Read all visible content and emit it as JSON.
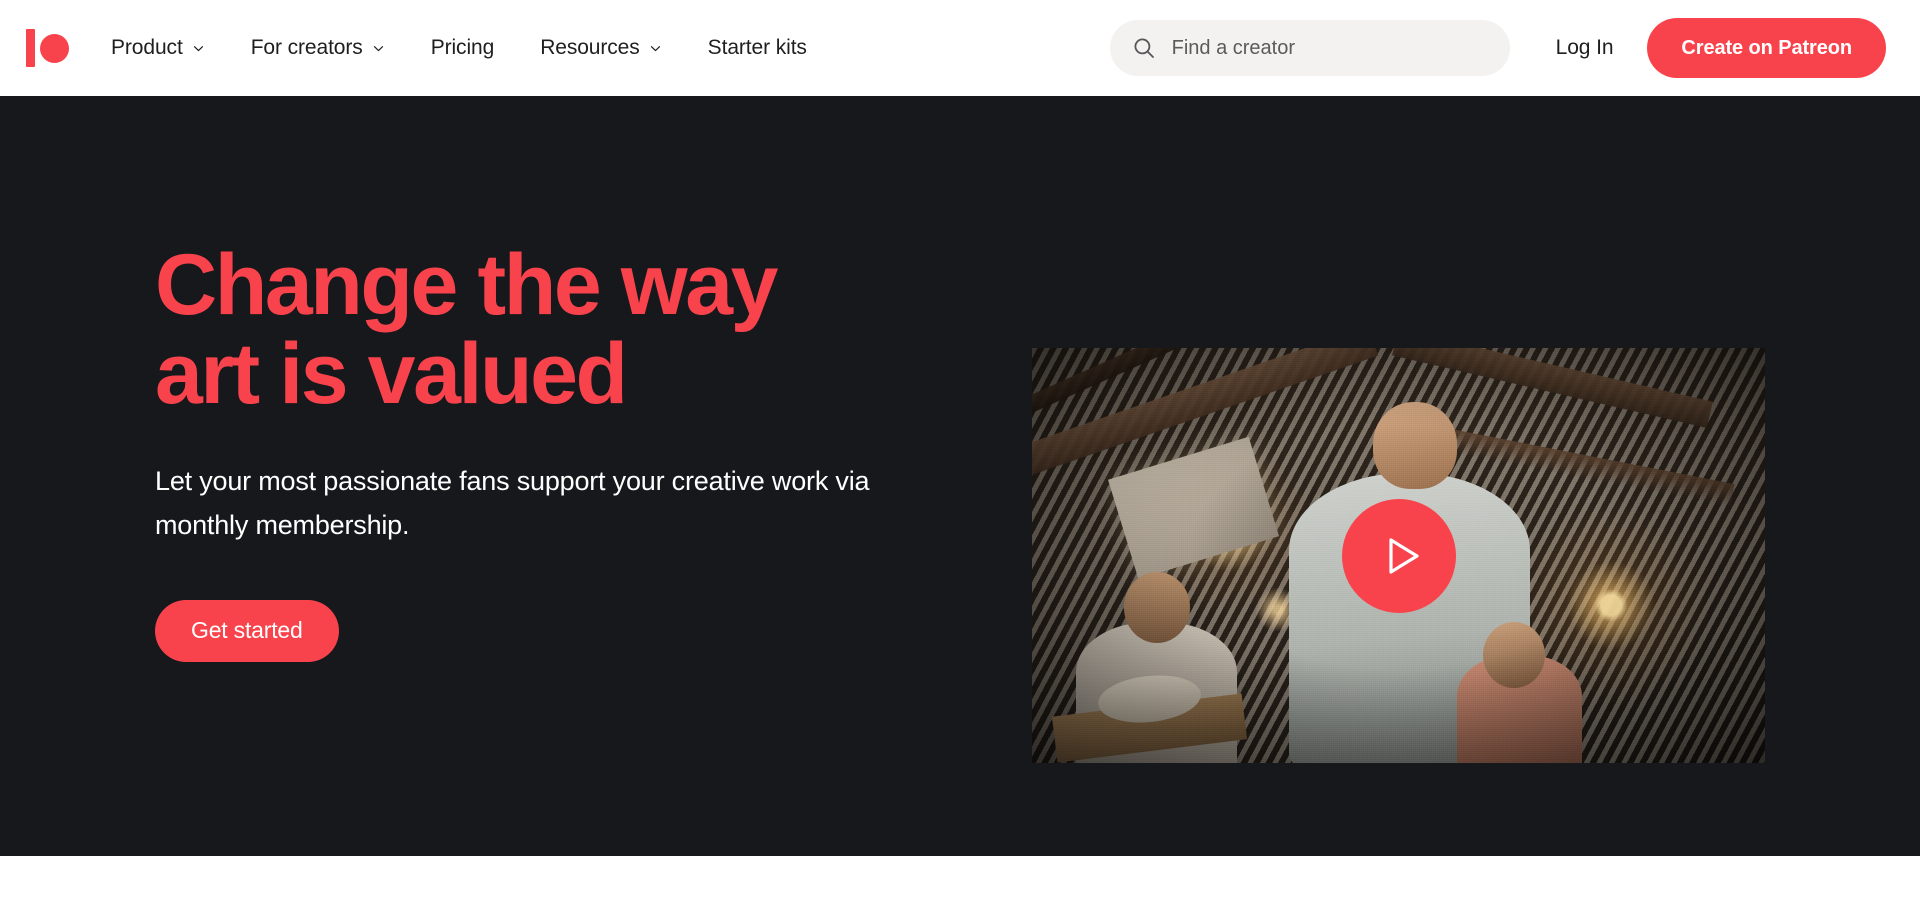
{
  "theme": {
    "brand_coral": "#F9434C",
    "hero_background": "#17181C",
    "header_background": "#FFFFFF",
    "search_background": "#F3F2F0",
    "nav_text": "#1F1F21"
  },
  "header": {
    "logo_name": "patreon-logo",
    "nav": [
      {
        "label": "Product",
        "has_dropdown": true
      },
      {
        "label": "For creators",
        "has_dropdown": true
      },
      {
        "label": "Pricing",
        "has_dropdown": false
      },
      {
        "label": "Resources",
        "has_dropdown": true
      },
      {
        "label": "Starter kits",
        "has_dropdown": false
      }
    ],
    "search": {
      "placeholder": "Find a creator",
      "value": "",
      "icon": "search-icon"
    },
    "login_label": "Log In",
    "cta_label": "Create on Patreon"
  },
  "hero": {
    "title": "Change the way art is valued",
    "subtitle": "Let your most passionate fans support your creative work via monthly membership.",
    "button_label": "Get started",
    "video": {
      "play_icon": "play-icon",
      "alt": "Musician performing in a dimly lit studio with warm stage lights"
    }
  }
}
